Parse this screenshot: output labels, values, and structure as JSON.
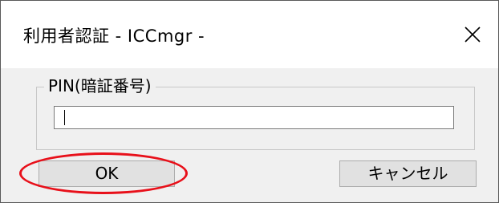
{
  "window": {
    "title": "利用者認証 - ICCmgr -",
    "close_icon": "close-icon"
  },
  "pin_group": {
    "legend": "PIN(暗証番号)",
    "input_value": ""
  },
  "buttons": {
    "ok_label": "OK",
    "cancel_label": "キャンセル"
  },
  "annotation": {
    "highlight_color": "#e8101a"
  },
  "colors": {
    "dialog_background": "#f0f0f0",
    "titlebar_background": "#ffffff",
    "button_face": "#e1e1e1"
  }
}
